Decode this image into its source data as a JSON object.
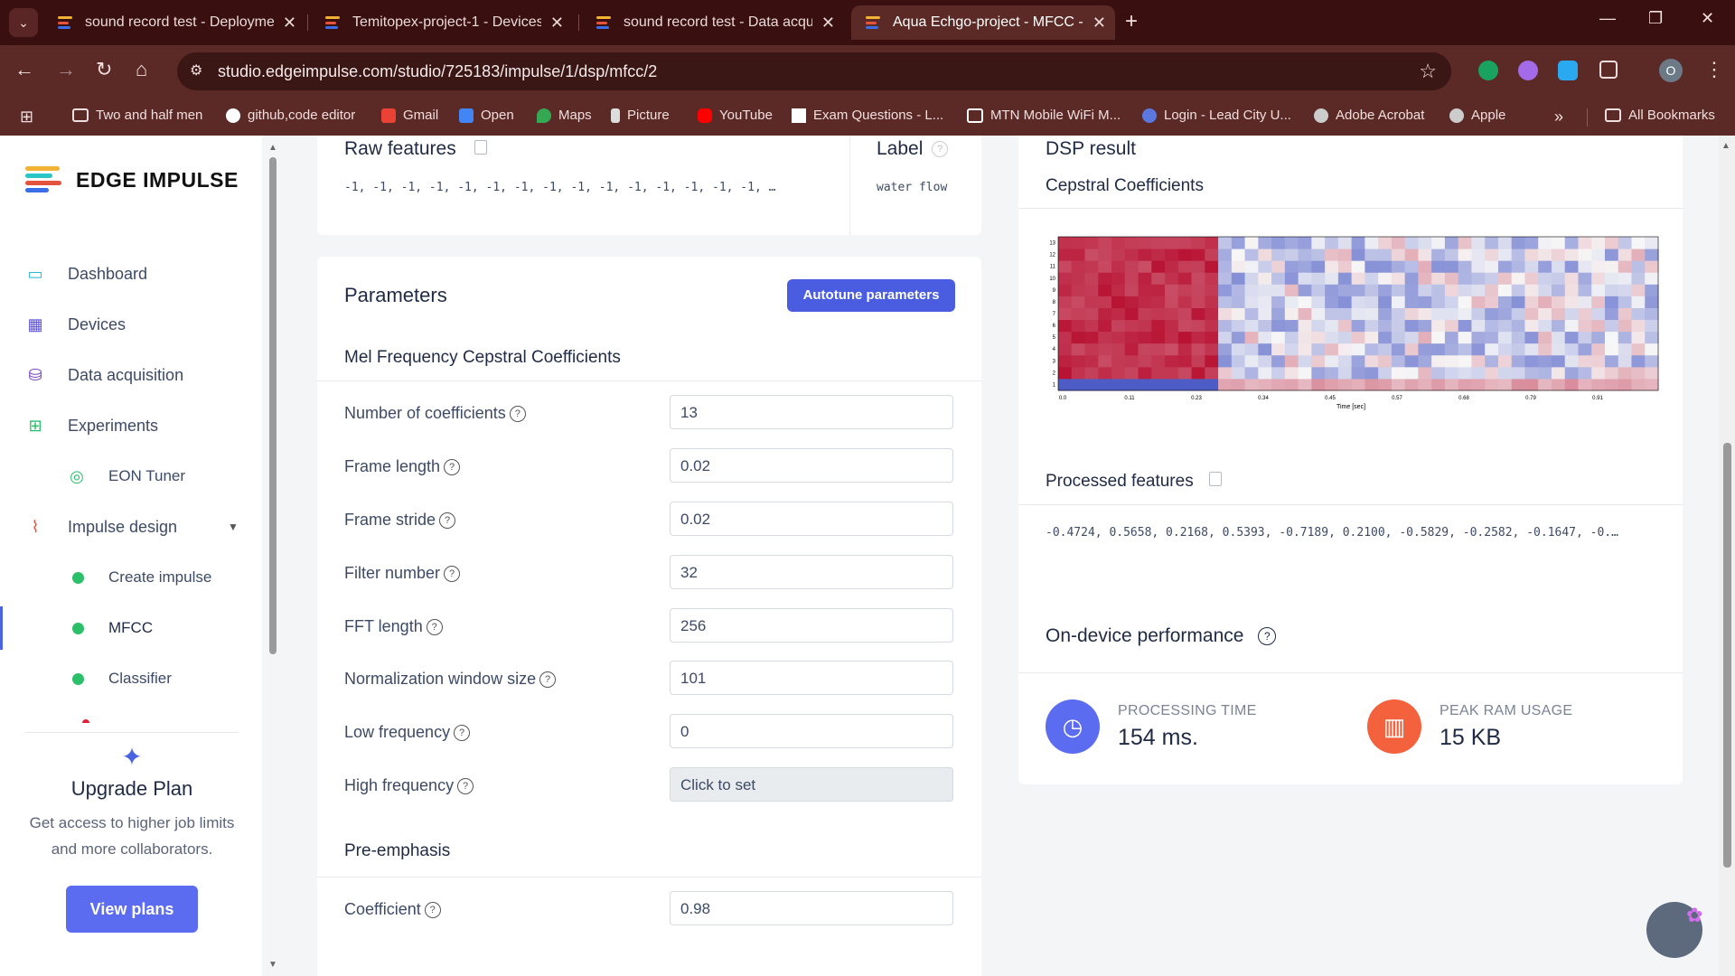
{
  "browser": {
    "tabs": [
      {
        "title": "sound record test - Deploymen",
        "active": false
      },
      {
        "title": "Temitopex-project-1 - Devices",
        "active": false
      },
      {
        "title": "sound record test - Data acquis",
        "active": false
      },
      {
        "title": "Aqua Echgo-project - MFCC - E",
        "active": true
      }
    ],
    "url": "studio.edgeimpulse.com/studio/725183/impulse/1/dsp/mfcc/2",
    "profile_initial": "O",
    "bookmarks": [
      "Two and half men",
      "github,code editor",
      "Gmail",
      "Open",
      "Maps",
      "Picture",
      "YouTube",
      "Exam Questions - L...",
      "MTN Mobile WiFi M...",
      "Login - Lead City U...",
      "Adobe Acrobat",
      "Apple"
    ],
    "all_bookmarks": "All Bookmarks",
    "overflow": "»"
  },
  "sidebar": {
    "brand": "EDGE IMPULSE",
    "items": [
      {
        "label": "Dashboard",
        "icon": "monitor-icon"
      },
      {
        "label": "Devices",
        "icon": "chip-icon"
      },
      {
        "label": "Data acquisition",
        "icon": "database-icon"
      },
      {
        "label": "Experiments",
        "icon": "grid-icon"
      },
      {
        "label": "EON Tuner",
        "icon": "compass-icon"
      },
      {
        "label": "Impulse design",
        "icon": "pulse-icon"
      },
      {
        "label": "Create impulse",
        "icon": "dot-icon"
      },
      {
        "label": "MFCC",
        "icon": "dot-icon"
      },
      {
        "label": "Classifier",
        "icon": "dot-icon"
      }
    ],
    "upgrade": {
      "title": "Upgrade Plan",
      "text": "Get access to higher job limits and more collaborators.",
      "button": "View plans"
    }
  },
  "raw": {
    "title": "Raw features",
    "values": "-1, -1, -1, -1, -1, -1, -1, -1, -1, -1, -1, -1, -1, -1, -1, …",
    "label_title": "Label",
    "label_value": "water flow"
  },
  "parameters": {
    "title": "Parameters",
    "autotune": "Autotune parameters",
    "mfcc_title": "Mel Frequency Cepstral Coefficients",
    "rows": [
      {
        "label": "Number of coefficients",
        "value": "13"
      },
      {
        "label": "Frame length",
        "value": "0.02"
      },
      {
        "label": "Frame stride",
        "value": "0.02"
      },
      {
        "label": "Filter number",
        "value": "32"
      },
      {
        "label": "FFT length",
        "value": "256"
      },
      {
        "label": "Normalization window size",
        "value": "101"
      },
      {
        "label": "Low frequency",
        "value": "0"
      },
      {
        "label": "High frequency",
        "value": "Click to set"
      }
    ],
    "preemph_title": "Pre-emphasis",
    "coefficient_label": "Coefficient",
    "coefficient_value": "0.98"
  },
  "dsp": {
    "title": "DSP result",
    "cepstral_title": "Cepstral Coefficients",
    "processed_title": "Processed features",
    "processed_values": "-0.4724, 0.5658, 0.2168, 0.5393, -0.7189, 0.2100, -0.5829, -0.2582, -0.1647, -0.…"
  },
  "chart_data": {
    "type": "heatmap",
    "xlabel": "Time [sec]",
    "x_ticks": [
      "0.0",
      "0.11",
      "0.23",
      "0.34",
      "0.45",
      "0.57",
      "0.68",
      "0.79",
      "0.91"
    ],
    "y_ticks": [
      "1",
      "2",
      "3",
      "4",
      "5",
      "6",
      "7",
      "8",
      "9",
      "10",
      "11",
      "12",
      "13"
    ],
    "colormap": [
      "#3b4cc0",
      "#f7f7f7",
      "#b40426"
    ],
    "description_rows": 13,
    "columns": 45
  },
  "performance": {
    "title": "On-device performance",
    "processing_label": "PROCESSING TIME",
    "processing_value": "154 ms.",
    "ram_label": "PEAK RAM USAGE",
    "ram_value": "15 KB"
  }
}
